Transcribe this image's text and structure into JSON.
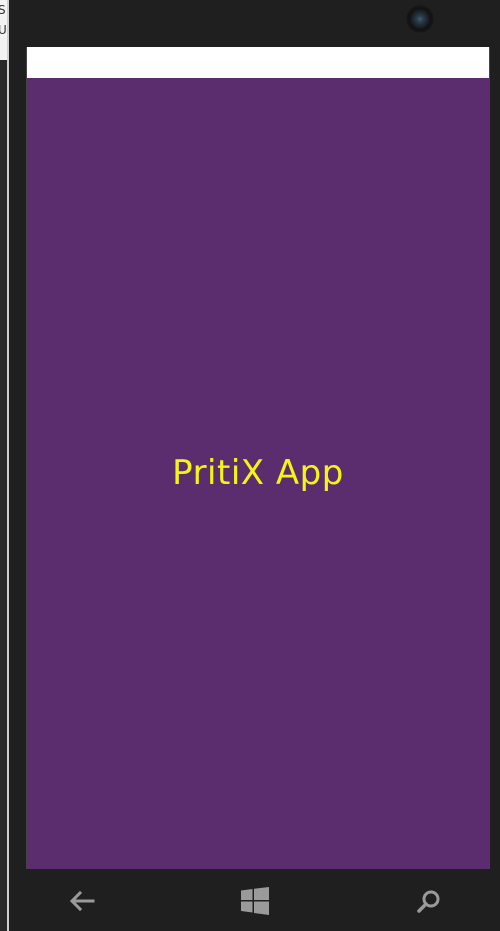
{
  "app": {
    "title": "PritiX App"
  },
  "background_window": {
    "text_line_1": "S",
    "text_line_2": "U"
  },
  "colors": {
    "splash_background": "#5c2d6e",
    "title_color": "#f5f514",
    "frame": "#1f1f1f",
    "status_strip": "#ffffff"
  },
  "navigation": {
    "back_icon": "back-arrow-icon",
    "start_icon": "windows-logo-icon",
    "search_icon": "search-icon"
  }
}
